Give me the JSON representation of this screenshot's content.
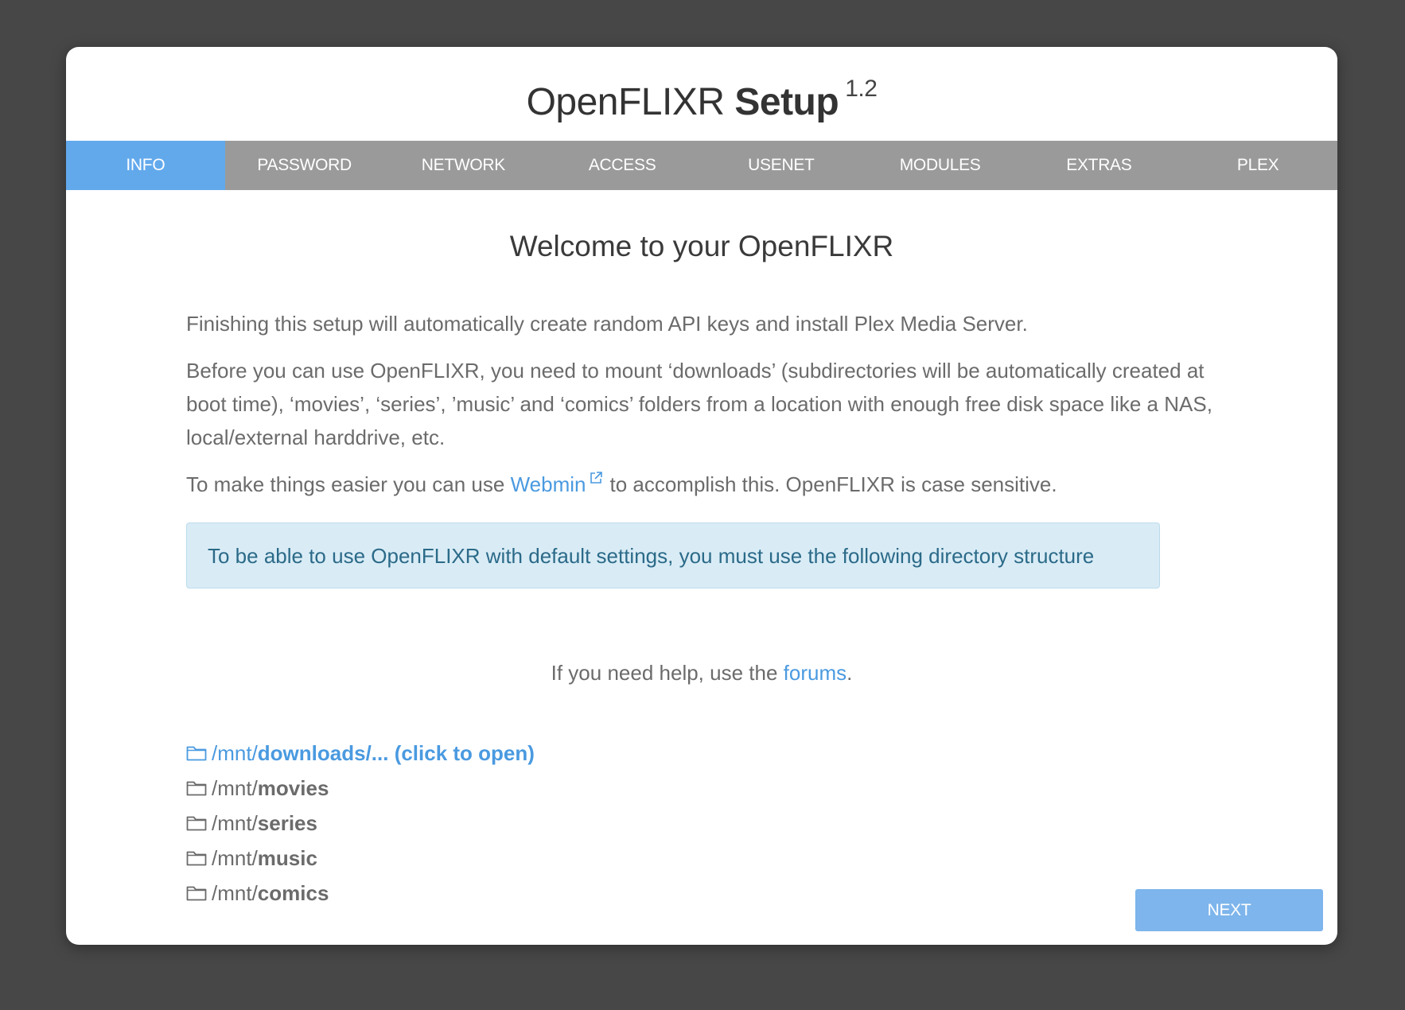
{
  "header": {
    "title_light": "OpenFLIXR",
    "title_bold": "Setup",
    "version": "1.2"
  },
  "tabs": [
    {
      "label": "INFO",
      "active": true
    },
    {
      "label": "PASSWORD",
      "active": false
    },
    {
      "label": "NETWORK",
      "active": false
    },
    {
      "label": "ACCESS",
      "active": false
    },
    {
      "label": "USENET",
      "active": false
    },
    {
      "label": "MODULES",
      "active": false
    },
    {
      "label": "EXTRAS",
      "active": false
    },
    {
      "label": "PLEX",
      "active": false
    }
  ],
  "main": {
    "heading": "Welcome to your OpenFLIXR",
    "paragraph1": "Finishing this setup will automatically create random API keys and install Plex Media Server.",
    "paragraph2": "Before you can use OpenFLIXR, you need to mount ‘downloads’ (subdirectories will be automatically created at boot time), ‘movies’, ‘series’, ’music’ and ‘comics’ folders from a location with enough free disk space like a NAS, local/external harddrive, etc.",
    "paragraph3_before": "To make things easier you can use",
    "paragraph3_link": "Webmin",
    "paragraph3_after": "to accomplish this. OpenFLIXR is case sensitive.",
    "alert": "To be able to use OpenFLIXR with default settings, you must use the following directory structure",
    "help_before": "If you need help, use the",
    "help_link": "forums",
    "help_after": "."
  },
  "directories": [
    {
      "prefix": "/mnt/",
      "name": "downloads/... (click to open)",
      "clickable": true
    },
    {
      "prefix": "/mnt/",
      "name": "movies",
      "clickable": false
    },
    {
      "prefix": "/mnt/",
      "name": "series",
      "clickable": false
    },
    {
      "prefix": "/mnt/",
      "name": "music",
      "clickable": false
    },
    {
      "prefix": "/mnt/",
      "name": "comics",
      "clickable": false
    }
  ],
  "footer": {
    "next_label": "NEXT"
  },
  "icons": {
    "external_link": "external-link-icon",
    "folder": "folder-icon"
  },
  "colors": {
    "accent": "#62a9ec",
    "link": "#4a9ae0",
    "tab_bar": "#9a9a9a",
    "alert_bg": "#d9ecf6",
    "alert_text": "#2b6a88",
    "next_button": "#7db5ec"
  }
}
